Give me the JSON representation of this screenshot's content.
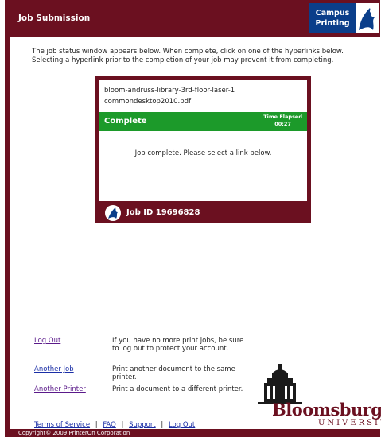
{
  "header": {
    "title": "Job Submission",
    "campus_line1": "Campus",
    "campus_line2": "Printing"
  },
  "intro": "The job status window appears below. When complete, click on one of the hyperlinks below. Selecting a hyperlink prior to the completion of your job may prevent it from completing.",
  "status": {
    "printer": "bloom-andruss-library-3rd-floor-laser-1",
    "file": "commondesktop2010.pdf",
    "state": "Complete",
    "elapsed_label": "Time Elapsed",
    "elapsed_value": "00:27",
    "message": "Job complete. Please select a link below.",
    "job_id": "Job ID 19696828"
  },
  "links": [
    {
      "label": "Log Out",
      "description": "If you have no more print jobs, be sure to log out to protect your account."
    },
    {
      "label": "Another Job",
      "description": "Print another document to the same printer."
    },
    {
      "label": "Another Printer",
      "description": "Print a document to a different printer."
    }
  ],
  "logo": {
    "name": "Bloomsburg",
    "sub": "UNIVERSITY"
  },
  "footer": {
    "terms": "Terms of Service",
    "faq": "FAQ",
    "support": "Support",
    "logout": "Log Out",
    "sep": "|"
  },
  "copyright": "Copyright© 2009 PrinterOn Corporation",
  "colors": {
    "maroon": "#6b1020",
    "green": "#1c9a2a",
    "blue": "#0b3e8a",
    "link": "#1a2ea6"
  }
}
